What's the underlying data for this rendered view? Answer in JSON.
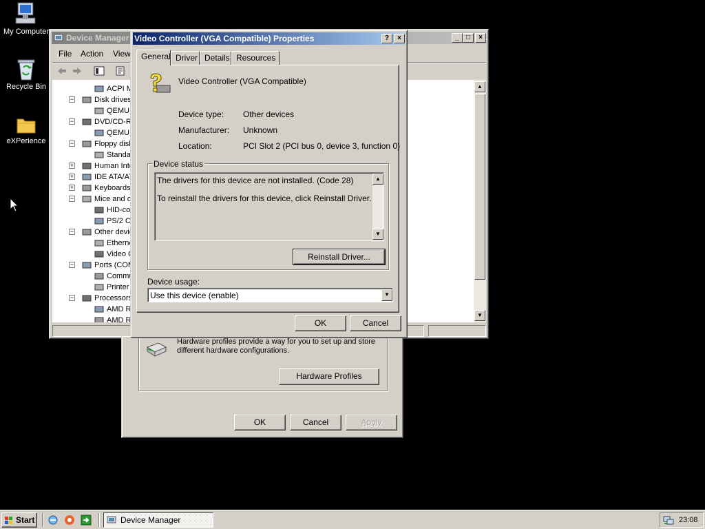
{
  "desktop": {
    "icons": [
      {
        "label": "My Computer"
      },
      {
        "label": "Recycle Bin"
      },
      {
        "label": "eXPerience"
      }
    ]
  },
  "device_manager": {
    "title": "Device Manager",
    "menu": [
      "File",
      "Action",
      "View"
    ],
    "tree": [
      {
        "label": "ACPI M",
        "level": 2,
        "expander": ""
      },
      {
        "label": "Disk drives",
        "level": 1,
        "expander": "-"
      },
      {
        "label": "QEMU H",
        "level": 2,
        "expander": ""
      },
      {
        "label": "DVD/CD-RO",
        "level": 1,
        "expander": "-"
      },
      {
        "label": "QEMU Q",
        "level": 2,
        "expander": ""
      },
      {
        "label": "Floppy disk",
        "level": 1,
        "expander": "-"
      },
      {
        "label": "Standa",
        "level": 2,
        "expander": ""
      },
      {
        "label": "Human Inte",
        "level": 1,
        "expander": "+"
      },
      {
        "label": "IDE ATA/AT",
        "level": 1,
        "expander": "+"
      },
      {
        "label": "Keyboards",
        "level": 1,
        "expander": "+"
      },
      {
        "label": "Mice and ot",
        "level": 1,
        "expander": "-"
      },
      {
        "label": "HID-con",
        "level": 2,
        "expander": ""
      },
      {
        "label": "PS/2 Co",
        "level": 2,
        "expander": ""
      },
      {
        "label": "Other devic",
        "level": 1,
        "expander": "-"
      },
      {
        "label": "Etherne",
        "level": 2,
        "expander": ""
      },
      {
        "label": "Video C",
        "level": 2,
        "expander": ""
      },
      {
        "label": "Ports (COM",
        "level": 1,
        "expander": "-"
      },
      {
        "label": "Commu",
        "level": 2,
        "expander": ""
      },
      {
        "label": "Printer",
        "level": 2,
        "expander": ""
      },
      {
        "label": "Processors",
        "level": 1,
        "expander": "-"
      },
      {
        "label": "AMD Ry",
        "level": 2,
        "expander": ""
      },
      {
        "label": "AMD Ry",
        "level": 2,
        "expander": ""
      }
    ]
  },
  "back_dialog": {
    "text": "Hardware profiles provide a way for you to set up and store different hardware configurations.",
    "hardware_profiles_button": "Hardware Profiles",
    "ok": "OK",
    "cancel": "Cancel",
    "apply": "Apply"
  },
  "properties": {
    "title": "Video Controller (VGA Compatible) Properties",
    "tabs": [
      "General",
      "Driver",
      "Details",
      "Resources"
    ],
    "device_name": "Video Controller (VGA Compatible)",
    "device_type_label": "Device type:",
    "device_type_value": "Other devices",
    "manufacturer_label": "Manufacturer:",
    "manufacturer_value": "Unknown",
    "location_label": "Location:",
    "location_value": "PCI Slot 2 (PCI bus 0, device 3, function 0)",
    "status_group": "Device status",
    "status_line1": "The drivers for this device are not installed. (Code 28)",
    "status_line2": "To reinstall the drivers for this device, click Reinstall Driver.",
    "reinstall_button": "Reinstall Driver...",
    "usage_label": "Device usage:",
    "usage_value": "Use this device (enable)",
    "ok": "OK",
    "cancel": "Cancel"
  },
  "taskbar": {
    "start": "Start",
    "task": "Device Manager",
    "clock": "23:08"
  }
}
